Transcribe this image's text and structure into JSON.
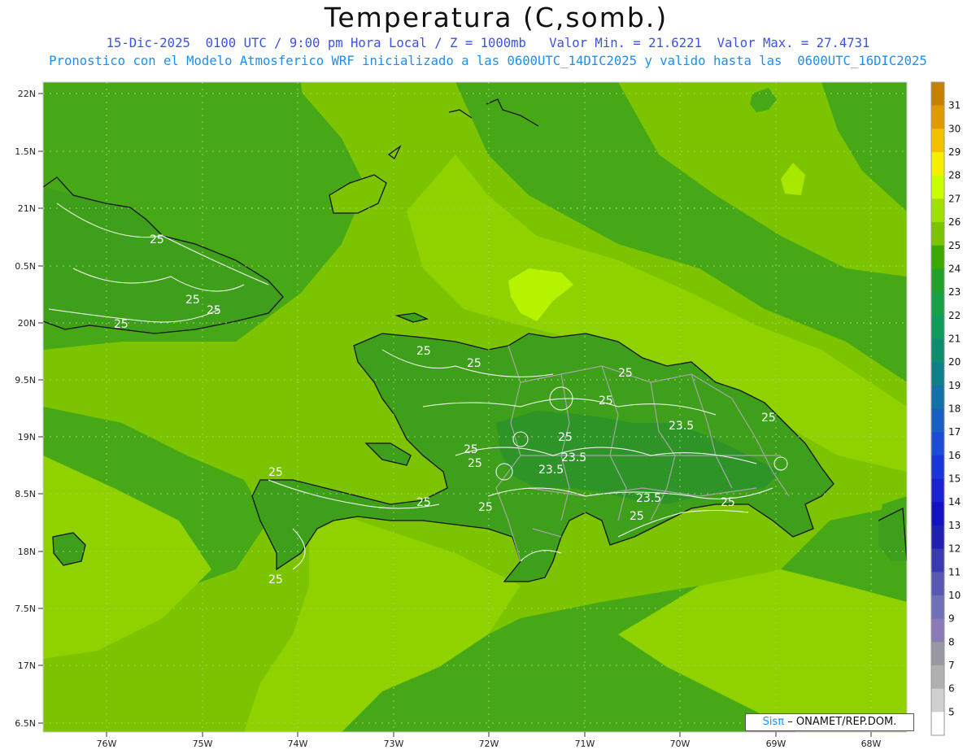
{
  "title": "Temperatura (C,somb.)",
  "subtitle_1": "15-Dic-2025  0100 UTC / 9:00 pm Hora Local / Z = 1000mb   Valor Min. = 21.6221  Valor Max. = 27.4731",
  "subtitle_2": "Pronostico con el Modelo Atmosferico WRF inicializado a las 0600UTC_14DIC2025 y valido hasta las  0600UTC_16DIC2025",
  "credit": {
    "brand": "Sisπ",
    "text": "– ONAMET/REP.DOM."
  },
  "axes": {
    "lat_labels": [
      "22N",
      "1.5N",
      "21N",
      "0.5N",
      "20N",
      "9.5N",
      "19N",
      "8.5N",
      "18N",
      "7.5N",
      "17N",
      "6.5N"
    ],
    "lon_labels": [
      "76W",
      "75W",
      "74W",
      "73W",
      "72W",
      "71W",
      "70W",
      "69W",
      "68W"
    ]
  },
  "colorbar": {
    "labels": [
      "31",
      "30",
      "29",
      "28",
      "27",
      "26",
      "25",
      "24",
      "23",
      "22",
      "21",
      "20",
      "19",
      "18",
      "17",
      "16",
      "15",
      "14",
      "13",
      "12",
      "11",
      "10",
      "9",
      "8",
      "7",
      "6",
      "5"
    ],
    "colors": [
      "#c88000",
      "#e09a00",
      "#f5c000",
      "#f5f000",
      "#c8ff00",
      "#9ee000",
      "#7cc400",
      "#3aaa00",
      "#22a02a",
      "#18a046",
      "#119a5a",
      "#0e8c6e",
      "#0f7f8a",
      "#1470a8",
      "#1760c2",
      "#1a4cd6",
      "#1a36d8",
      "#1a22d2",
      "#1212c0",
      "#2020b0",
      "#3a3ab0",
      "#5858b4",
      "#7070b8",
      "#8a7ab8",
      "#9898a0",
      "#b0b0b0",
      "#d0d0d0",
      "#ffffff"
    ]
  },
  "contour_labels": [
    "25",
    "25",
    "25",
    "25",
    "25",
    "25",
    "25",
    "25",
    "25",
    "25",
    "25",
    "25",
    "25",
    "25",
    "25",
    "23.5",
    "23.5",
    "23.5",
    "23.5",
    "25",
    "25",
    "25"
  ],
  "colors": {
    "base_24": "#47a817",
    "band_25": "#7cc400",
    "band_26": "#8fd200",
    "band_27": "#b6f300",
    "band_23": "#36a030"
  }
}
